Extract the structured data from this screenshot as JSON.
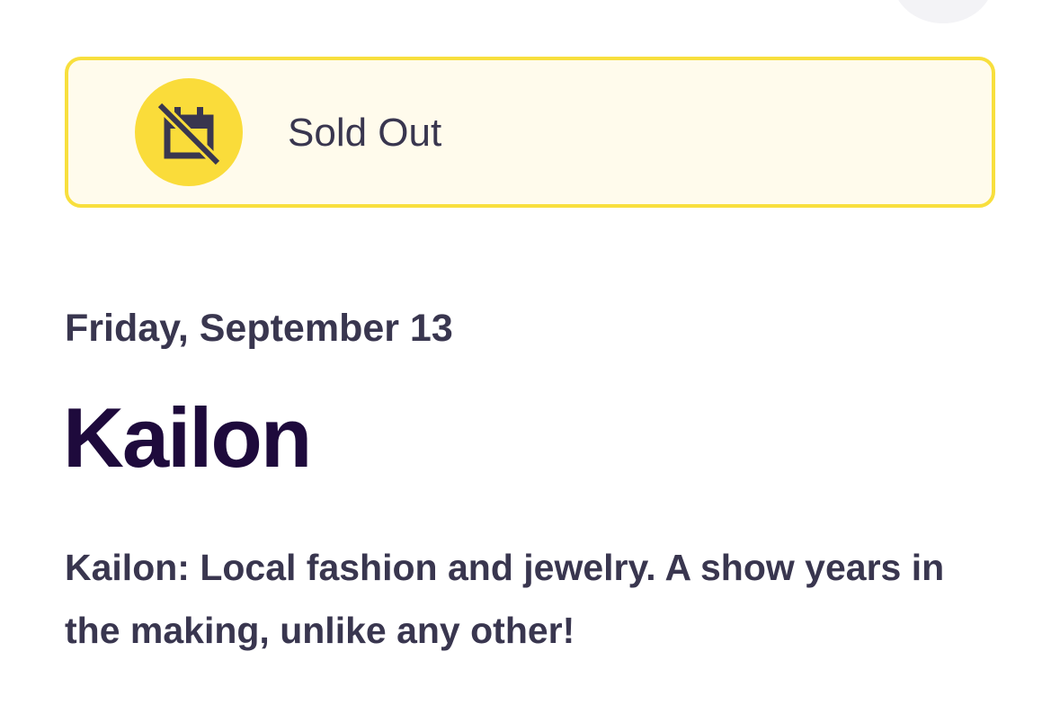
{
  "banner": {
    "status_label": "Sold Out",
    "icon": "calendar-off-icon",
    "border_color": "#f8df3d",
    "background_color": "#fffbec",
    "icon_circle_color": "#fadc3a"
  },
  "event": {
    "date": "Friday, September 13",
    "title": "Kailon",
    "summary": "Kailon: Local fashion and jewelry. A show years in the making, unlike any other!"
  },
  "colors": {
    "text_primary": "#1e0a3c",
    "text_secondary": "#39364f"
  }
}
